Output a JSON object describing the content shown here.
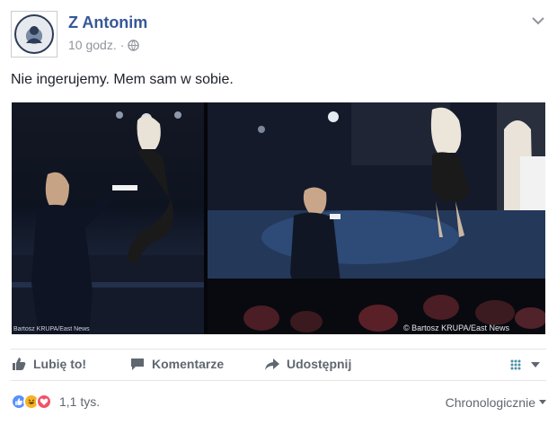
{
  "post": {
    "author": "Z Antonim",
    "time": "10 godz.",
    "separator": "·",
    "text": "Nie ingerujemy. Mem sam w sobie.",
    "photo_credit_left": "Bartosz KRUPA/East News",
    "photo_credit_right": "© Bartosz KRUPA/East News"
  },
  "actions": {
    "like": "Lubię to!",
    "comment": "Komentarze",
    "share": "Udostępnij"
  },
  "footer": {
    "reaction_count": "1,1 tys.",
    "sort_label": "Chronologicznie",
    "reactions": [
      "like-icon",
      "haha-icon",
      "love-icon"
    ]
  },
  "colors": {
    "link": "#365899",
    "like": "#5890ff",
    "haha": "#f7b125",
    "love": "#f25268"
  }
}
